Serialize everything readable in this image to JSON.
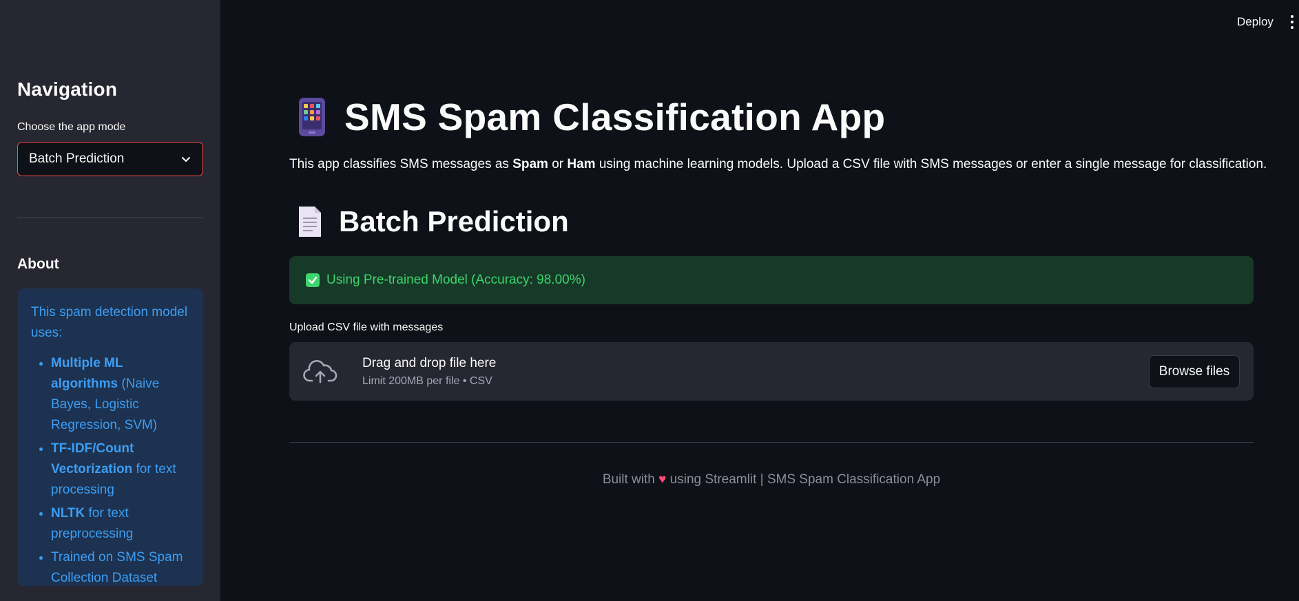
{
  "header": {
    "deploy_label": "Deploy"
  },
  "sidebar": {
    "nav_title": "Navigation",
    "select_label": "Choose the app mode",
    "select_value": "Batch Prediction",
    "about_title": "About",
    "about_intro": "This spam detection model uses:",
    "about_items": [
      {
        "bold": "Multiple ML algorithms",
        "rest": " (Naive Bayes, Logistic Regression, SVM)"
      },
      {
        "bold": "TF-IDF/Count Vectorization",
        "rest": " for text processing"
      },
      {
        "bold": "NLTK",
        "rest": " for text preprocessing"
      },
      {
        "bold": "",
        "rest": "Trained on SMS Spam Collection Dataset"
      }
    ]
  },
  "main": {
    "title": "SMS Spam Classification App",
    "title_icon": "mobile-phone-icon",
    "desc_part1": "This app classifies SMS messages as ",
    "desc_spam": "Spam",
    "desc_or": " or ",
    "desc_ham": "Ham",
    "desc_part2": " using machine learning models. Upload a CSV file with SMS messages or enter a single message for classification.",
    "section_title": "Batch Prediction",
    "section_icon": "document-icon",
    "success_text": "Using Pre-trained Model (Accuracy: 98.00%)",
    "upload_label": "Upload CSV file with messages",
    "dropzone_main": "Drag and drop file here",
    "dropzone_sub": "Limit 200MB per file • CSV",
    "browse_label": "Browse files",
    "footer_before": "Built with ",
    "footer_heart": "♥",
    "footer_after": " using Streamlit | SMS Spam Classification App"
  },
  "colors": {
    "background": "#0e1117",
    "sidebar": "#262730",
    "accent": "#ff4b4b",
    "info_bg": "#1c3250",
    "info_text": "#3d9df3",
    "success_bg": "#173928",
    "success_text": "#3dd56d"
  }
}
